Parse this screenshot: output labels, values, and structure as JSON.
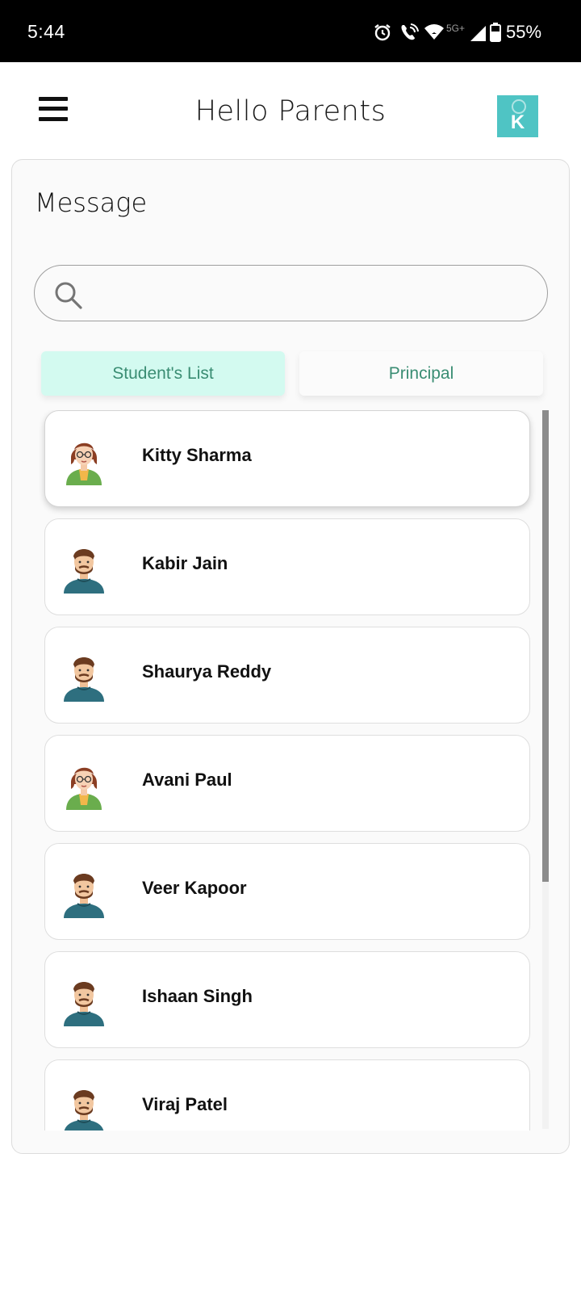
{
  "status_bar": {
    "time": "5:44",
    "network": "5G+",
    "battery": "55%"
  },
  "header": {
    "title": "Hello Parents",
    "logo_letter": "K",
    "logo_color": "#4fc4c4"
  },
  "message": {
    "title": "Message",
    "search_placeholder": ""
  },
  "tabs": [
    {
      "label": "Student's List",
      "active": true
    },
    {
      "label": "Principal",
      "active": false
    }
  ],
  "students": [
    {
      "name": "Kitty Sharma",
      "avatar": "girl-avatar-icon"
    },
    {
      "name": "Kabir Jain",
      "avatar": "boy-avatar-icon"
    },
    {
      "name": "Shaurya Reddy",
      "avatar": "boy-avatar-icon"
    },
    {
      "name": "Avani Paul",
      "avatar": "girl-avatar-icon"
    },
    {
      "name": "Veer Kapoor",
      "avatar": "boy-avatar-icon"
    },
    {
      "name": "Ishaan Singh",
      "avatar": "boy-avatar-icon"
    },
    {
      "name": "Viraj Patel",
      "avatar": "boy-avatar-icon"
    }
  ],
  "colors": {
    "accent_tab_bg": "#d3faf0",
    "accent_text": "#3a8d73"
  }
}
